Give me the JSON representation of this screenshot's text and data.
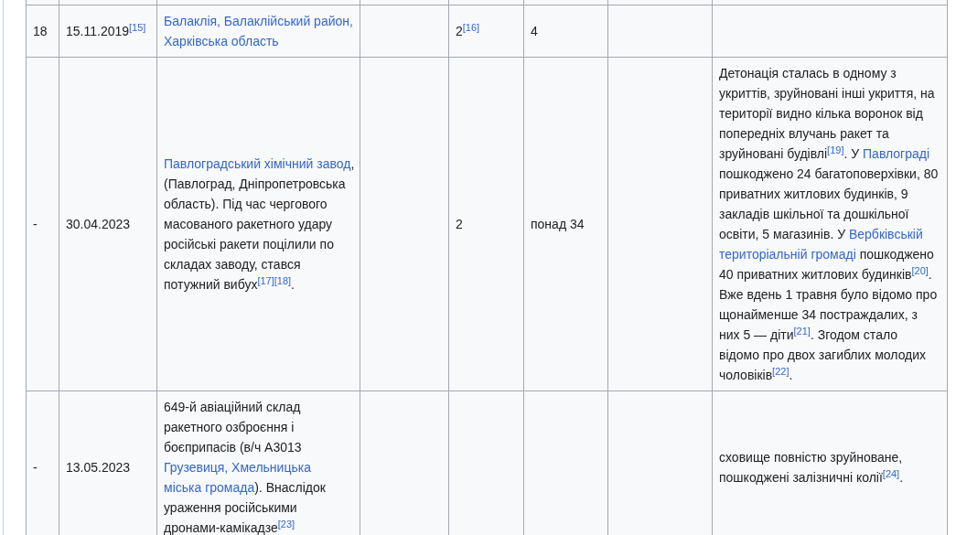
{
  "table": {
    "rows": [
      {
        "cells": [
          {
            "kind": "text",
            "parts": [
              {
                "kind": "text",
                "text": "18"
              }
            ]
          },
          {
            "kind": "text",
            "parts": [
              {
                "kind": "text",
                "text": "15.11.2019"
              },
              {
                "kind": "ref",
                "text": "[15]"
              }
            ]
          },
          {
            "kind": "text",
            "parts": [
              {
                "kind": "link",
                "text": "Балаклія, Балаклійський район, Харківська область"
              }
            ]
          },
          {
            "kind": "empty"
          },
          {
            "kind": "text",
            "parts": [
              {
                "kind": "text",
                "text": "2"
              },
              {
                "kind": "ref",
                "text": "[16]"
              }
            ]
          },
          {
            "kind": "text",
            "parts": [
              {
                "kind": "text",
                "text": "4"
              }
            ]
          },
          {
            "kind": "empty"
          },
          {
            "kind": "empty"
          }
        ]
      },
      {
        "cells": [
          {
            "kind": "text",
            "parts": [
              {
                "kind": "text",
                "text": "-"
              }
            ]
          },
          {
            "kind": "text",
            "parts": [
              {
                "kind": "text",
                "text": "30.04.2023"
              }
            ]
          },
          {
            "kind": "text",
            "parts": [
              {
                "kind": "link",
                "text": "Павлоградський хімічний завод"
              },
              {
                "kind": "text",
                "text": ", (Павлоград, Дніпропетровська область). Під час чергового масованого ракетного удару російські ракети поцілили по складах заводу, стався потужний вибух"
              },
              {
                "kind": "ref",
                "text": "[17]"
              },
              {
                "kind": "ref",
                "text": "[18]"
              },
              {
                "kind": "text",
                "text": "."
              }
            ]
          },
          {
            "kind": "empty"
          },
          {
            "kind": "text",
            "parts": [
              {
                "kind": "text",
                "text": "2"
              }
            ]
          },
          {
            "kind": "text",
            "parts": [
              {
                "kind": "text",
                "text": "понад 34"
              }
            ]
          },
          {
            "kind": "empty"
          },
          {
            "kind": "text",
            "parts": [
              {
                "kind": "text",
                "text": "Детонація сталась в одному з укриттів, зруйновані інші укриття, на території видно кілька воронок від попередніх влучань ракет та зруйновані будівлі"
              },
              {
                "kind": "ref",
                "text": "[19]"
              },
              {
                "kind": "text",
                "text": ". У "
              },
              {
                "kind": "link",
                "text": "Павлограді"
              },
              {
                "kind": "text",
                "text": " пошкоджено 24 багатоповерхівки, 80 приватних житлових будинків, 9 закладів шкільної та дошкільної освіти, 5 магазинів. У "
              },
              {
                "kind": "link",
                "text": "Вербківській"
              },
              {
                "kind": "space"
              },
              {
                "kind": "link",
                "text": "територіальній громаді"
              },
              {
                "kind": "text",
                "text": " пошкоджено 40 приватних житлових будинків"
              },
              {
                "kind": "ref",
                "text": "[20]"
              },
              {
                "kind": "text",
                "text": ". Вже вдень 1 травня було відомо про щонайменше 34 постраждалих, з них 5 — діти"
              },
              {
                "kind": "ref",
                "text": "[21]"
              },
              {
                "kind": "text",
                "text": ". Згодом стало відомо про двох загиблих молодих чоловіків"
              },
              {
                "kind": "ref",
                "text": "[22]"
              },
              {
                "kind": "text",
                "text": "."
              }
            ]
          }
        ]
      },
      {
        "cells": [
          {
            "kind": "text",
            "parts": [
              {
                "kind": "text",
                "text": "-"
              }
            ]
          },
          {
            "kind": "text",
            "parts": [
              {
                "kind": "text",
                "text": "13.05.2023"
              }
            ]
          },
          {
            "kind": "text",
            "parts": [
              {
                "kind": "text",
                "text": "649-й авіаційний склад ракетного озброєння і боєприпасів (в/ч А3013 "
              },
              {
                "kind": "link",
                "text": "Грузевиця, Хмельницька"
              },
              {
                "kind": "space"
              },
              {
                "kind": "link",
                "text": "міська громада"
              },
              {
                "kind": "text",
                "text": "). Внаслідок ураження російськими дронами-камікадзе"
              },
              {
                "kind": "ref",
                "text": "[23]"
              }
            ]
          },
          {
            "kind": "empty"
          },
          {
            "kind": "empty"
          },
          {
            "kind": "empty"
          },
          {
            "kind": "empty"
          },
          {
            "kind": "text",
            "parts": [
              {
                "kind": "text",
                "text": "сховище повністю зруйноване, пошкоджені залізничні колії"
              },
              {
                "kind": "ref",
                "text": "[24]"
              },
              {
                "kind": "text",
                "text": "."
              }
            ]
          }
        ]
      }
    ]
  }
}
